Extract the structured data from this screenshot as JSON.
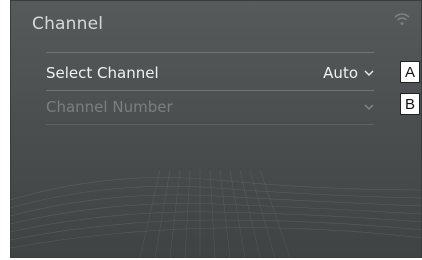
{
  "screen": {
    "title": "Channel",
    "icons": {
      "signal": "signal-strength-icon",
      "chevron": "chevron-down-icon"
    }
  },
  "rows": [
    {
      "label": "Select Channel",
      "value": "Auto",
      "enabled": true
    },
    {
      "label": "Channel Number",
      "value": "",
      "enabled": false
    }
  ],
  "callouts": [
    "A",
    "B"
  ],
  "colors": {
    "background": "#4b4f50",
    "text": "#f0f1f1",
    "disabled_text": "#7a7f80"
  }
}
